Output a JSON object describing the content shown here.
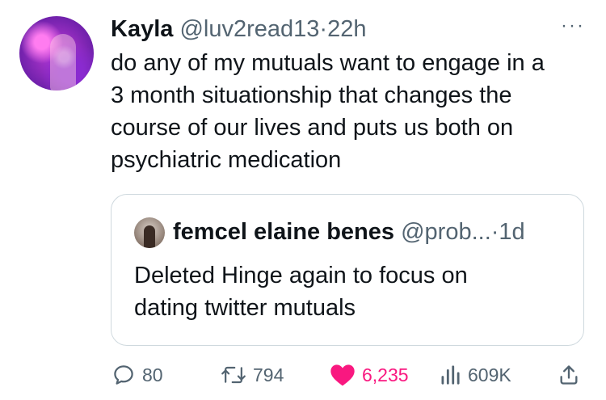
{
  "tweet": {
    "author_name": "Kayla",
    "handle": "@luv2read13",
    "separator": "·",
    "time": "22h",
    "more_label": "···",
    "text_lines": [
      "do any of my mutuals want to engage in a",
      "3 month situationship that changes the",
      "course of our lives and puts us both on",
      "psychiatric medication"
    ]
  },
  "quote": {
    "author_name": "femcel elaine benes",
    "handle": "@prob...",
    "separator": "·",
    "time": "1d",
    "text_lines": [
      "Deleted Hinge again to focus on",
      "dating twitter mutuals"
    ]
  },
  "actions": {
    "replies": "80",
    "retweets": "794",
    "likes": "6,235",
    "views": "609K"
  },
  "colors": {
    "text": "#0f1419",
    "muted": "#536471",
    "like": "#f91880",
    "border": "#cfd9de"
  },
  "icons": [
    "reply-icon",
    "retweet-icon",
    "heart-icon",
    "views-icon",
    "share-icon",
    "more-icon"
  ]
}
